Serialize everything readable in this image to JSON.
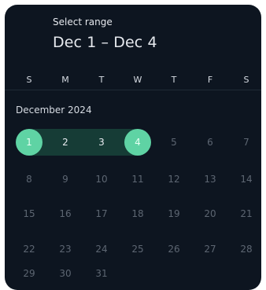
{
  "header": {
    "label": "Select range",
    "value": "Dec 1 – Dec 4"
  },
  "weekdays": [
    "S",
    "M",
    "T",
    "W",
    "T",
    "F",
    "S"
  ],
  "month_label": "December 2024",
  "weeks": [
    [
      "1",
      "2",
      "3",
      "4",
      "5",
      "6",
      "7"
    ],
    [
      "8",
      "9",
      "10",
      "11",
      "12",
      "13",
      "14"
    ],
    [
      "15",
      "16",
      "17",
      "18",
      "19",
      "20",
      "21"
    ],
    [
      "22",
      "23",
      "24",
      "25",
      "26",
      "27",
      "28"
    ],
    [
      "29",
      "30",
      "31"
    ]
  ],
  "selection": {
    "start": "1",
    "end": "4"
  },
  "colors": {
    "background": "#0d1520",
    "endpoint": "#5fd3a4",
    "range_band": "#163c36",
    "muted_day": "#5d6672",
    "text": "#e6e9ee"
  }
}
